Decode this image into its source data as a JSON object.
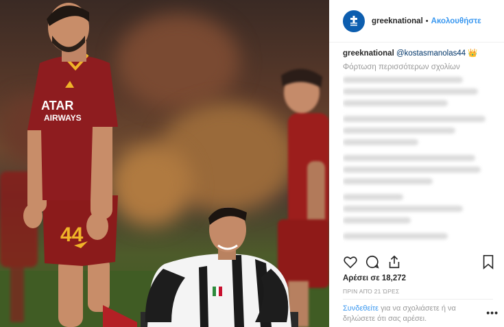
{
  "post": {
    "username": "greeknational",
    "separator": "•",
    "follow_label": "Ακολουθήστε"
  },
  "caption": {
    "username": "greeknational",
    "mention": "@kostasmanolas44",
    "emoji": "👑"
  },
  "load_more_label": "Φόρτωση περισσότερων σχολίων",
  "blurred_comment_widths": [
    0.8,
    0.9,
    0.7,
    0.95,
    0.75,
    0.5,
    0.88,
    0.92,
    0.6,
    0.4,
    0.8,
    0.45,
    0.7
  ],
  "likes_label": "Αρέσει σε 18,272",
  "time_label": "ΠΡΙΝ ΑΠΌ 21 ΏΡΕΣ",
  "login": {
    "link_label": "Συνδεθείτε",
    "rest_text": " για να σχολιάσετε ή να δηλώσετε ότι σας αρέσει."
  },
  "more_label": "•••",
  "photo": {
    "player_left_number": "44",
    "player_left_sponsor": "QATAR AIRWAYS",
    "colors": {
      "roma_red": "#8b1b1b",
      "roma_gold": "#f0b429",
      "pitch": "#3e5a22"
    }
  },
  "icons": [
    "greek-flag-icon",
    "heart-icon",
    "comment-icon",
    "share-icon",
    "bookmark-icon"
  ],
  "colors": {
    "link": "#3897f0",
    "text": "#262626",
    "muted": "#999999"
  }
}
